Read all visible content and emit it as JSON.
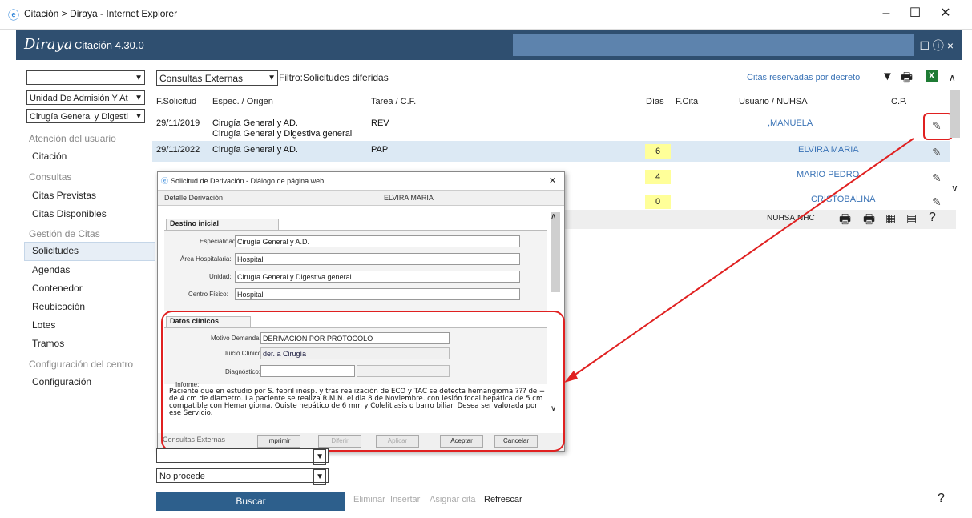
{
  "window": {
    "title": "Citación > Diraya - Internet Explorer",
    "controls": {
      "minimize": "–",
      "maximize": "☐",
      "close": "✕"
    }
  },
  "app": {
    "logo": "Diraya",
    "version_label": "Citación 4.30.0",
    "header_icons": "☐ ⓘ ×"
  },
  "sidebar": {
    "select1": "",
    "select2": "Unidad De Admisión Y At",
    "select3": "Cirugía General y Digesti",
    "sections": [
      {
        "title": "Atención del usuario",
        "items": [
          "Citación"
        ]
      },
      {
        "title": "Consultas",
        "items": [
          "Citas Previstas",
          "Citas Disponibles"
        ]
      },
      {
        "title": "Gestión de Citas",
        "items": [
          "Solicitudes",
          "Agendas",
          "Contenedor",
          "Reubicación",
          "Lotes",
          "Tramos"
        ]
      },
      {
        "title": "Configuración del centro",
        "items": [
          "Configuración"
        ]
      }
    ],
    "selected_item": "Solicitudes",
    "lower_select1": "",
    "lower_select2": "No procede",
    "search_button": "Buscar"
  },
  "main": {
    "consultas_select": "Consultas Externas",
    "filter_label": "Filtro:Solicitudes diferidas",
    "reserved_link": "Citas reservadas por decreto",
    "columns": [
      "F.Solicitud",
      "Espec. / Origen",
      "Tarea / C.F.",
      "Días",
      "F.Cita",
      "Usuario / NUHSA",
      "C.P."
    ],
    "rows": [
      {
        "fecha": "29/11/2019",
        "espec": "Cirugía General y AD.",
        "espec2": "Cirugía General y Digestiva general",
        "tarea": "REV",
        "dias": "",
        "usuario": ",MANUELA"
      },
      {
        "fecha": "29/11/2022",
        "espec": "Cirugía General y AD.",
        "espec2": "",
        "tarea": "PAP",
        "dias": "6",
        "usuario": "ELVIRA MARIA"
      },
      {
        "fecha": "",
        "espec": "",
        "espec2": "",
        "tarea": "",
        "dias": "4",
        "usuario": "MARIO PEDRO"
      },
      {
        "fecha": "",
        "espec": "",
        "espec2": "",
        "tarea": "",
        "dias": "0",
        "usuario": "CRISTOBALINA"
      }
    ],
    "bar_labels": {
      "nuhsa": "NUHSA",
      "nhc": "NHC"
    },
    "bottom_links": {
      "eliminar": "Eliminar",
      "insertar": "Insertar",
      "asignar": "Asignar cita",
      "refrescar": "Refrescar"
    }
  },
  "dialog": {
    "title": "Solicitud de Derivación - Diálogo de página web",
    "detail_label": "Detalle Derivación",
    "patient": "ELVIRA MARIA",
    "destino": {
      "section": "Destino inicial",
      "especialidad_label": "Especialidad:",
      "especialidad": "Cirugía General y A.D.",
      "area_label": "Área Hospitalaria:",
      "area": "Hospital",
      "unidad_label": "Unidad:",
      "unidad": "Cirugía General y Digestiva general",
      "centro_label": "Centro Físico:",
      "centro": "Hospital"
    },
    "clinicos": {
      "section": "Datos clínicos",
      "motivo_label": "Motivo Demanda:",
      "motivo": "DERIVACION POR PROTOCOLO",
      "juicio_label": "Juicio Clínico:",
      "juicio": "der. a Cirugía",
      "diagnostico_label": "Diagnóstico:",
      "diagnostico": "",
      "informe_label": "Informe:",
      "informe": "Paciente que en estudio por S. febril inesp. y tras realización de ECO y TAC se detecta hemangioma ??? de + de 4 cm de diametro. La paciente se realiza R.M.N. el dia 8 de Noviembre. con lesión focal hepática de 5 cm compatible con Hemangioma, Quiste hepático de 6 mm y Colelitiasis o barro biliar. Desea ser valorada por ese Servicio."
    },
    "footer_label": "Consultas Externas",
    "buttons": {
      "imprimir": "Imprimir",
      "diferir": "Diferir",
      "aplicar": "Aplicar",
      "aceptar": "Aceptar",
      "cancelar": "Cancelar"
    }
  },
  "colors": {
    "header": "#2f4f70",
    "accent": "#2d5f8c",
    "callout": "#e02020",
    "highlight": "#ffff99",
    "link": "#3a73b6"
  }
}
